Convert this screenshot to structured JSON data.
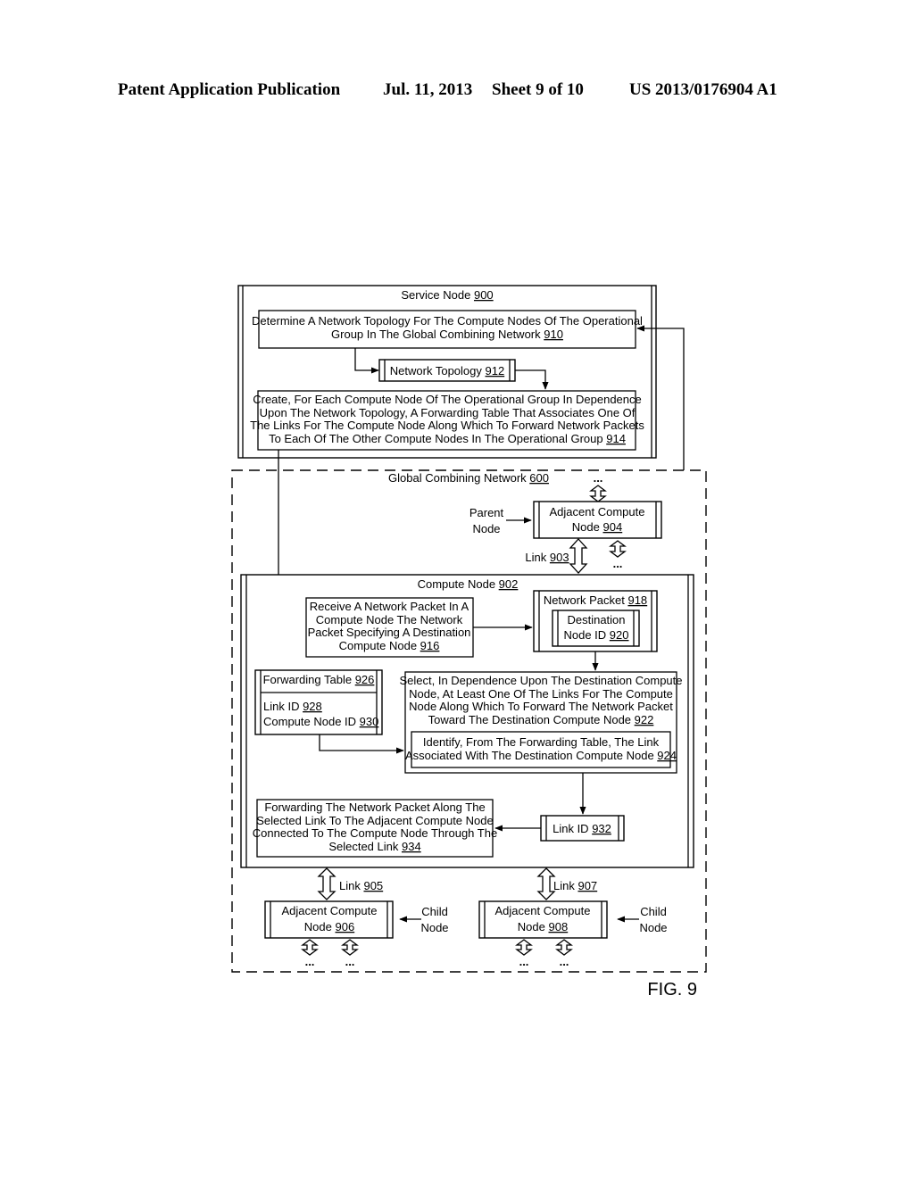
{
  "header": {
    "publication": "Patent Application Publication",
    "date": "Jul. 11, 2013",
    "sheet": "Sheet 9 of 10",
    "number": "US 2013/0176904 A1"
  },
  "figure": {
    "label": "FIG. 9",
    "service_node": {
      "text": "Service Node ",
      "ref": "900"
    },
    "step_910": {
      "lines": [
        "Determine A Network Topology For The Compute Nodes Of The Operational",
        "Group In The Global Combining Network "
      ],
      "ref": "910"
    },
    "topology_912": {
      "text": "Network Topology ",
      "ref": "912"
    },
    "step_914": {
      "lines": [
        "Create, For Each Compute Node Of The Operational Group In Dependence",
        "Upon The Network Topology, A Forwarding Table That Associates One Of",
        "The Links For The Compute Node Along Which To Forward Network Packets",
        "To Each Of The Other Compute Nodes In The Operational Group "
      ],
      "ref": "914"
    },
    "network_600": {
      "text": "Global Combining Network ",
      "ref": "600"
    },
    "parent_label": [
      "Parent",
      "Node"
    ],
    "node_904": {
      "lines": [
        "Adjacent Compute",
        "Node "
      ],
      "ref": "904"
    },
    "link_903": {
      "text": "Link ",
      "ref": "903"
    },
    "compute_902": {
      "text": "Compute Node ",
      "ref": "902"
    },
    "step_916": {
      "lines": [
        "Receive A Network Packet In A",
        "Compute Node The Network",
        "Packet Specifying A Destination",
        "Compute Node "
      ],
      "ref": "916"
    },
    "packet_918": {
      "text": "Network Packet ",
      "ref": "918"
    },
    "dest_920": {
      "lines": [
        "Destination",
        "Node ID "
      ],
      "ref": "920"
    },
    "table_926": {
      "text": "Forwarding Table ",
      "ref": "926"
    },
    "link_id_928": {
      "text": "Link ID ",
      "ref": "928"
    },
    "compute_id_930": {
      "text": "Compute Node ID ",
      "ref": "930"
    },
    "step_922": {
      "lines": [
        "Select, In Dependence Upon The Destination Compute",
        "Node, At Least One Of The Links For The Compute",
        "Node Along Which To Forward The Network Packet",
        "Toward The Destination Compute Node "
      ],
      "ref": "922"
    },
    "step_924": {
      "lines": [
        "Identify, From The Forwarding Table, The Link",
        "Associated With The Destination Compute Node "
      ],
      "ref": "924"
    },
    "link_id_932": {
      "text": "Link ID ",
      "ref": "932"
    },
    "step_934": {
      "lines": [
        "Forwarding The Network Packet Along The",
        "Selected Link To The Adjacent Compute Node",
        "Connected To The Compute Node Through The",
        "Selected Link "
      ],
      "ref": "934"
    },
    "link_905": {
      "text": "Link ",
      "ref": "905"
    },
    "link_907": {
      "text": "Link ",
      "ref": "907"
    },
    "node_906": {
      "lines": [
        "Adjacent Compute",
        "Node "
      ],
      "ref": "906"
    },
    "node_908": {
      "lines": [
        "Adjacent Compute",
        "Node "
      ],
      "ref": "908"
    },
    "child_label": [
      "Child",
      "Node"
    ],
    "ellipsis": "..."
  }
}
